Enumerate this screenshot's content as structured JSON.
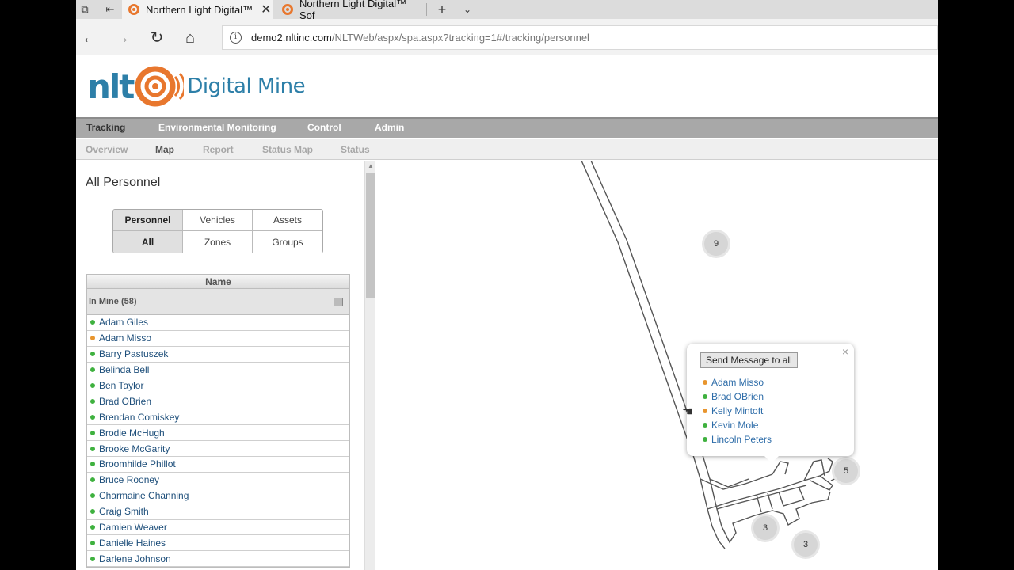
{
  "browser": {
    "tabs": [
      {
        "title": "Northern Light Digital™",
        "active": true
      },
      {
        "title": "Northern Light Digital™ Sof",
        "active": false
      }
    ],
    "new_tab_symbol": "+",
    "url_host": "demo2.nltinc.com",
    "url_path": "/NLTWeb/aspx/spa.aspx?tracking=1#/tracking/personnel",
    "icons": [
      "tab-actions-icon",
      "set-aside-tabs-icon",
      "back-icon",
      "forward-icon",
      "refresh-icon",
      "home-icon",
      "info-icon",
      "tab-list-chevron-icon",
      "close-icon"
    ]
  },
  "app": {
    "logo_nlt": "nlt",
    "logo_text": "Digital Mine",
    "colors": {
      "brand_blue": "#2d7fa8",
      "brand_orange": "#e8772e",
      "status_green": "#3fb13f",
      "status_orange": "#e8952e"
    }
  },
  "mainnav": [
    "Tracking",
    "Environmental Monitoring",
    "Control",
    "Admin"
  ],
  "subnav": [
    "Overview",
    "Map",
    "Report",
    "Status Map",
    "Status"
  ],
  "subnav_active": "Map",
  "panel": {
    "title": "All Personnel",
    "segments_row1": [
      "Personnel",
      "Vehicles",
      "Assets"
    ],
    "segments_row2": [
      "All",
      "Zones",
      "Groups"
    ],
    "table_header": "Name",
    "group_label": "In Mine (58)",
    "people": [
      {
        "name": "Adam Giles",
        "status": "green"
      },
      {
        "name": "Adam Misso",
        "status": "orange"
      },
      {
        "name": "Barry Pastuszek",
        "status": "green"
      },
      {
        "name": "Belinda Bell",
        "status": "green"
      },
      {
        "name": "Ben Taylor",
        "status": "green"
      },
      {
        "name": "Brad OBrien",
        "status": "green"
      },
      {
        "name": "Brendan Comiskey",
        "status": "green"
      },
      {
        "name": "Brodie McHugh",
        "status": "green"
      },
      {
        "name": "Brooke McGarity",
        "status": "green"
      },
      {
        "name": "Broomhilde Phillot",
        "status": "green"
      },
      {
        "name": "Bruce Rooney",
        "status": "green"
      },
      {
        "name": "Charmaine Channing",
        "status": "green"
      },
      {
        "name": "Craig Smith",
        "status": "green"
      },
      {
        "name": "Damien Weaver",
        "status": "green"
      },
      {
        "name": "Danielle Haines",
        "status": "green"
      },
      {
        "name": "Darlene Johnson",
        "status": "green"
      }
    ]
  },
  "map": {
    "clusters": [
      "9",
      "5",
      "3",
      "3"
    ],
    "popup": {
      "button_label": "Send Message to all",
      "close_symbol": "×",
      "people": [
        {
          "name": "Adam Misso",
          "status": "orange"
        },
        {
          "name": "Brad OBrien",
          "status": "green"
        },
        {
          "name": "Kelly Mintoft",
          "status": "orange"
        },
        {
          "name": "Kevin Mole",
          "status": "green"
        },
        {
          "name": "Lincoln Peters",
          "status": "green"
        }
      ]
    }
  }
}
